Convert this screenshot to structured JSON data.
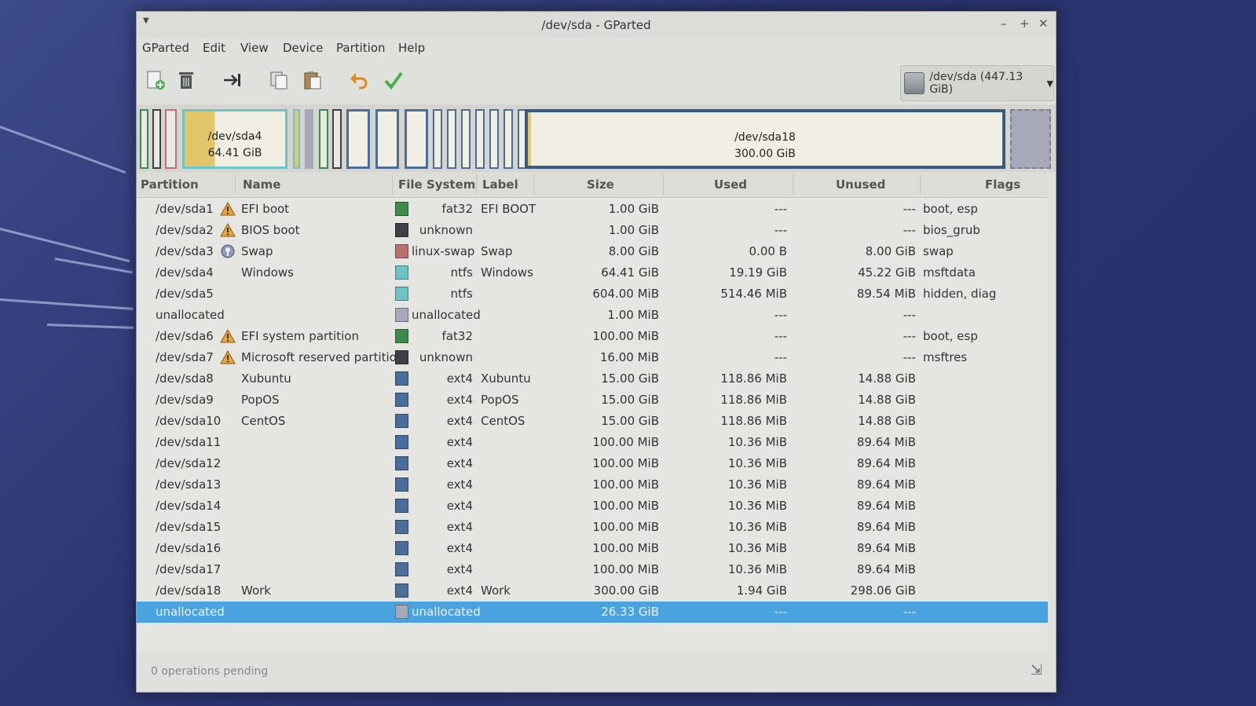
{
  "window": {
    "title": "/dev/sda - GParted"
  },
  "menubar": {
    "items": [
      "GParted",
      "Edit",
      "View",
      "Device",
      "Partition",
      "Help"
    ]
  },
  "toolbar": {
    "buttons": [
      "new-partition-icon",
      "delete-icon",
      "resize-move-icon",
      "copy-icon",
      "paste-icon",
      "undo-icon",
      "apply-icon"
    ],
    "device_selector": "/dev/sda (447.13 GiB)"
  },
  "disk_map": {
    "sda4": {
      "name": "/dev/sda4",
      "size": "64.41 GiB"
    },
    "sda18": {
      "name": "/dev/sda18",
      "size": "300.00 GiB"
    }
  },
  "columns": [
    "Partition",
    "Name",
    "File System",
    "Label",
    "Size",
    "Used",
    "Unused",
    "Flags"
  ],
  "colors": {
    "fat32": "#3e8a4a",
    "unknown": "#3d4044",
    "linux-swap": "#b87070",
    "ntfs": "#6ec4c4",
    "unallocated": "#a8a9b8",
    "ext4": "#4a6d99",
    "selected": "#4aa3de"
  },
  "rows": [
    {
      "partition": "/dev/sda1",
      "icon": "warning",
      "name": "EFI boot",
      "fs": "fat32",
      "label": "EFI BOOT",
      "size": "1.00 GiB",
      "used": "---",
      "unused": "---",
      "flags": "boot, esp"
    },
    {
      "partition": "/dev/sda2",
      "icon": "warning",
      "name": "BIOS boot",
      "fs": "unknown",
      "label": "",
      "size": "1.00 GiB",
      "used": "---",
      "unused": "---",
      "flags": "bios_grub"
    },
    {
      "partition": "/dev/sda3",
      "icon": "key",
      "name": "Swap",
      "fs": "linux-swap",
      "label": "Swap",
      "size": "8.00 GiB",
      "used": "0.00 B",
      "unused": "8.00 GiB",
      "flags": "swap"
    },
    {
      "partition": "/dev/sda4",
      "icon": "",
      "name": "Windows",
      "fs": "ntfs",
      "label": "Windows",
      "size": "64.41 GiB",
      "used": "19.19 GiB",
      "unused": "45.22 GiB",
      "flags": "msftdata"
    },
    {
      "partition": "/dev/sda5",
      "icon": "",
      "name": "",
      "fs": "ntfs",
      "label": "",
      "size": "604.00 MiB",
      "used": "514.46 MiB",
      "unused": "89.54 MiB",
      "flags": "hidden, diag"
    },
    {
      "partition": "unallocated",
      "icon": "",
      "name": "",
      "fs": "unallocated",
      "label": "",
      "size": "1.00 MiB",
      "used": "---",
      "unused": "---",
      "flags": ""
    },
    {
      "partition": "/dev/sda6",
      "icon": "warning",
      "name": "EFI system partition",
      "fs": "fat32",
      "label": "",
      "size": "100.00 MiB",
      "used": "---",
      "unused": "---",
      "flags": "boot, esp"
    },
    {
      "partition": "/dev/sda7",
      "icon": "warning",
      "name": "Microsoft reserved partition",
      "fs": "unknown",
      "label": "",
      "size": "16.00 MiB",
      "used": "---",
      "unused": "---",
      "flags": "msftres"
    },
    {
      "partition": "/dev/sda8",
      "icon": "",
      "name": "Xubuntu",
      "fs": "ext4",
      "label": "Xubuntu",
      "size": "15.00 GiB",
      "used": "118.86 MiB",
      "unused": "14.88 GiB",
      "flags": ""
    },
    {
      "partition": "/dev/sda9",
      "icon": "",
      "name": "PopOS",
      "fs": "ext4",
      "label": "PopOS",
      "size": "15.00 GiB",
      "used": "118.86 MiB",
      "unused": "14.88 GiB",
      "flags": ""
    },
    {
      "partition": "/dev/sda10",
      "icon": "",
      "name": "CentOS",
      "fs": "ext4",
      "label": "CentOS",
      "size": "15.00 GiB",
      "used": "118.86 MiB",
      "unused": "14.88 GiB",
      "flags": ""
    },
    {
      "partition": "/dev/sda11",
      "icon": "",
      "name": "",
      "fs": "ext4",
      "label": "",
      "size": "100.00 MiB",
      "used": "10.36 MiB",
      "unused": "89.64 MiB",
      "flags": ""
    },
    {
      "partition": "/dev/sda12",
      "icon": "",
      "name": "",
      "fs": "ext4",
      "label": "",
      "size": "100.00 MiB",
      "used": "10.36 MiB",
      "unused": "89.64 MiB",
      "flags": ""
    },
    {
      "partition": "/dev/sda13",
      "icon": "",
      "name": "",
      "fs": "ext4",
      "label": "",
      "size": "100.00 MiB",
      "used": "10.36 MiB",
      "unused": "89.64 MiB",
      "flags": ""
    },
    {
      "partition": "/dev/sda14",
      "icon": "",
      "name": "",
      "fs": "ext4",
      "label": "",
      "size": "100.00 MiB",
      "used": "10.36 MiB",
      "unused": "89.64 MiB",
      "flags": ""
    },
    {
      "partition": "/dev/sda15",
      "icon": "",
      "name": "",
      "fs": "ext4",
      "label": "",
      "size": "100.00 MiB",
      "used": "10.36 MiB",
      "unused": "89.64 MiB",
      "flags": ""
    },
    {
      "partition": "/dev/sda16",
      "icon": "",
      "name": "",
      "fs": "ext4",
      "label": "",
      "size": "100.00 MiB",
      "used": "10.36 MiB",
      "unused": "89.64 MiB",
      "flags": ""
    },
    {
      "partition": "/dev/sda17",
      "icon": "",
      "name": "",
      "fs": "ext4",
      "label": "",
      "size": "100.00 MiB",
      "used": "10.36 MiB",
      "unused": "89.64 MiB",
      "flags": ""
    },
    {
      "partition": "/dev/sda18",
      "icon": "",
      "name": "Work",
      "fs": "ext4",
      "label": "Work",
      "size": "300.00 GiB",
      "used": "1.94 GiB",
      "unused": "298.06 GiB",
      "flags": ""
    },
    {
      "partition": "unallocated",
      "icon": "",
      "name": "",
      "fs": "unallocated",
      "label": "",
      "size": "26.33 GiB",
      "used": "---",
      "unused": "---",
      "flags": "",
      "selected": true
    }
  ],
  "status": {
    "text": "0 operations pending"
  }
}
